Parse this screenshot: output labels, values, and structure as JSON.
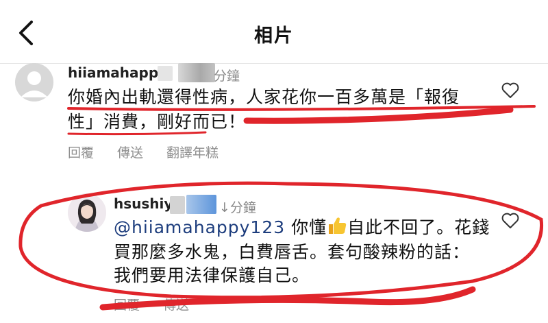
{
  "header": {
    "title": "相片"
  },
  "comments": [
    {
      "username": "hiiamahapp",
      "time": "分鐘",
      "text_line1": "你婚內出軌還得性病，人家花你一百多萬是「報復",
      "text_line2": "性」消費，剛好而已！",
      "actions": [
        "回覆",
        "傳送",
        "翻譯年糕"
      ]
    },
    {
      "username": "hsushiy",
      "time": "↓分鐘",
      "mention": "@hiiamahappy123",
      "text_line1_rest": " 你懂",
      "text_line1_after": "自此不回了。花錢",
      "text_line2": "買那麼多水鬼，白費唇舌。套句酸辣粉的話：",
      "text_line3": "我們要用法律保護自己。",
      "actions": [
        "回覆",
        "傳送"
      ]
    }
  ],
  "icons": {
    "back": "chevron-left-icon",
    "like": "heart-outline-icon",
    "emoji": "thumbs-up-emoji"
  },
  "colors": {
    "annotation_red": "#e0252b",
    "blur_gray": "#c9c9c9",
    "blur_blue": "#6fa3e0",
    "mention": "#1d3d7d",
    "secondary_text": "#8e8e8e"
  }
}
